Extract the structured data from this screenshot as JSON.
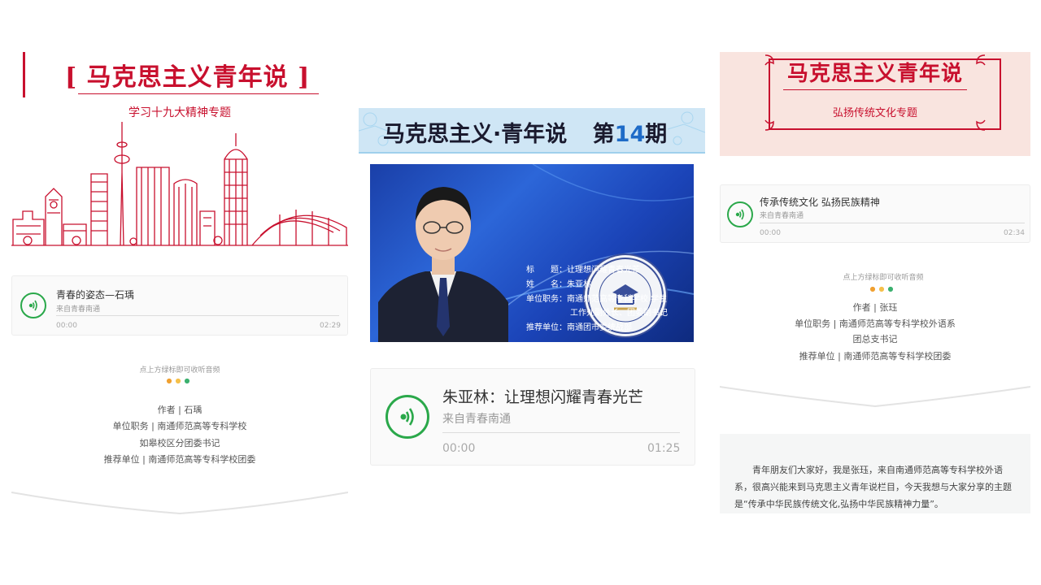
{
  "left": {
    "title": "[ 马克思主义青年说 ]",
    "subtitle": "学习十九大精神专题",
    "audio": {
      "title": "青春的姿态—石瑀",
      "source": "来自青春南通",
      "current": "00:00",
      "duration": "02:29"
    },
    "hint": "点上方绿标即可收听音频",
    "info": [
      "作者 | 石瑀",
      "单位职务 | 南通师范高等专科学校",
      "如皋校区分团委书记",
      "推荐单位 | 南通师范高等专科学校团委"
    ]
  },
  "middle": {
    "header_title": "马克思主义·青年说",
    "issue_prefix": "第",
    "issue_number": "14",
    "issue_suffix": "期",
    "badge_text": "南通市青年学院",
    "badge_ring_text": "Nantong Youth Marxist School",
    "photo_info": [
      "标　　题：让理想闪耀青春光芒",
      "姓　　名：朱亚林",
      "单位职务：南通师范高等专科学校 学生",
      "工作处副处长、团委副书记",
      "推荐单位：南通团市委统战部"
    ],
    "audio": {
      "title": "朱亚林：让理想闪耀青春光芒",
      "source": "来自青春南通",
      "current": "00:00",
      "duration": "01:25"
    }
  },
  "right": {
    "title": "马克思主义青年说",
    "subtitle": "弘扬传统文化专题",
    "audio": {
      "title": "传承传统文化 弘扬民族精神",
      "source": "来自青春南通",
      "current": "00:00",
      "duration": "02:34"
    },
    "hint": "点上方绿标即可收听音频",
    "info": [
      "作者 | 张珏",
      "单位职务 | 南通师范高等专科学校外语系",
      "团总支书记",
      "推荐单位 | 南通师范高等专科学校团委"
    ],
    "paragraph": "青年朋友们大家好，我是张珏，来自南通师范高等专科学校外语系，很高兴能来到马克思主义青年说栏目，今天我想与大家分享的主题是“传承中华民族传统文化,弘扬中华民族精神力量”。"
  },
  "colors": {
    "red": "#c8102e",
    "green": "#2aa84a",
    "blue_header": "#cfe6f5",
    "issue_blue": "#1e6bc7"
  },
  "dots_colors": [
    "#f0a030",
    "#f5c04a",
    "#3bb06e"
  ]
}
